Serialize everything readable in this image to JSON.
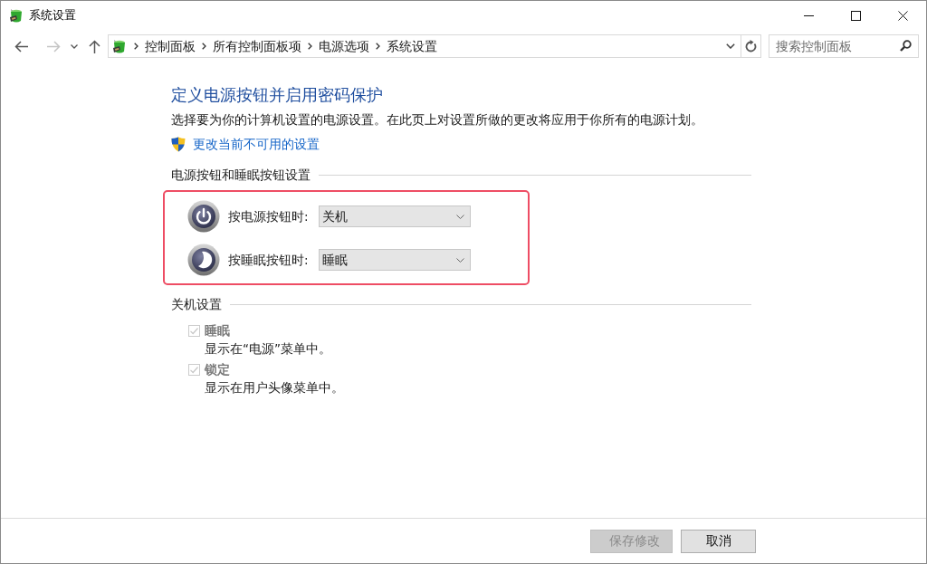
{
  "window": {
    "title": "系统设置"
  },
  "nav_buttons": [
    {
      "kind": "back",
      "disabled": false
    },
    {
      "kind": "forward",
      "disabled": true
    },
    {
      "kind": "recent",
      "disabled": false
    },
    {
      "kind": "up",
      "disabled": false
    }
  ],
  "address_bar": {
    "breadcrumbs": [
      "控制面板",
      "所有控制面板项",
      "电源选项",
      "系统设置"
    ]
  },
  "search_field": {
    "placeholder": "搜索控制面板"
  },
  "page": {
    "heading": "定义电源按钮并启用密码保护",
    "description": "选择要为你的计算机设置的电源设置。在此页上对设置所做的更改将应用于你所有的电源计划。",
    "admin_link": "更改当前不可用的设置"
  },
  "button_settings": {
    "title": "电源按钮和睡眠按钮设置",
    "highlighted": true,
    "rows": [
      {
        "kind": "power",
        "label": "按电源按钮时:",
        "value": "关机"
      },
      {
        "kind": "sleep",
        "label": "按睡眠按钮时:",
        "value": "睡眠"
      }
    ]
  },
  "shutdown_settings": {
    "title": "关机设置",
    "options": [
      {
        "label": "睡眠",
        "description": "显示在“电源”菜单中。",
        "checked": true,
        "disabled": true
      },
      {
        "label": "锁定",
        "description": "显示在用户头像菜单中。",
        "checked": true,
        "disabled": true
      }
    ]
  },
  "buttons": [
    {
      "label": "保存修改",
      "disabled": true
    },
    {
      "label": "取消",
      "disabled": false
    }
  ]
}
